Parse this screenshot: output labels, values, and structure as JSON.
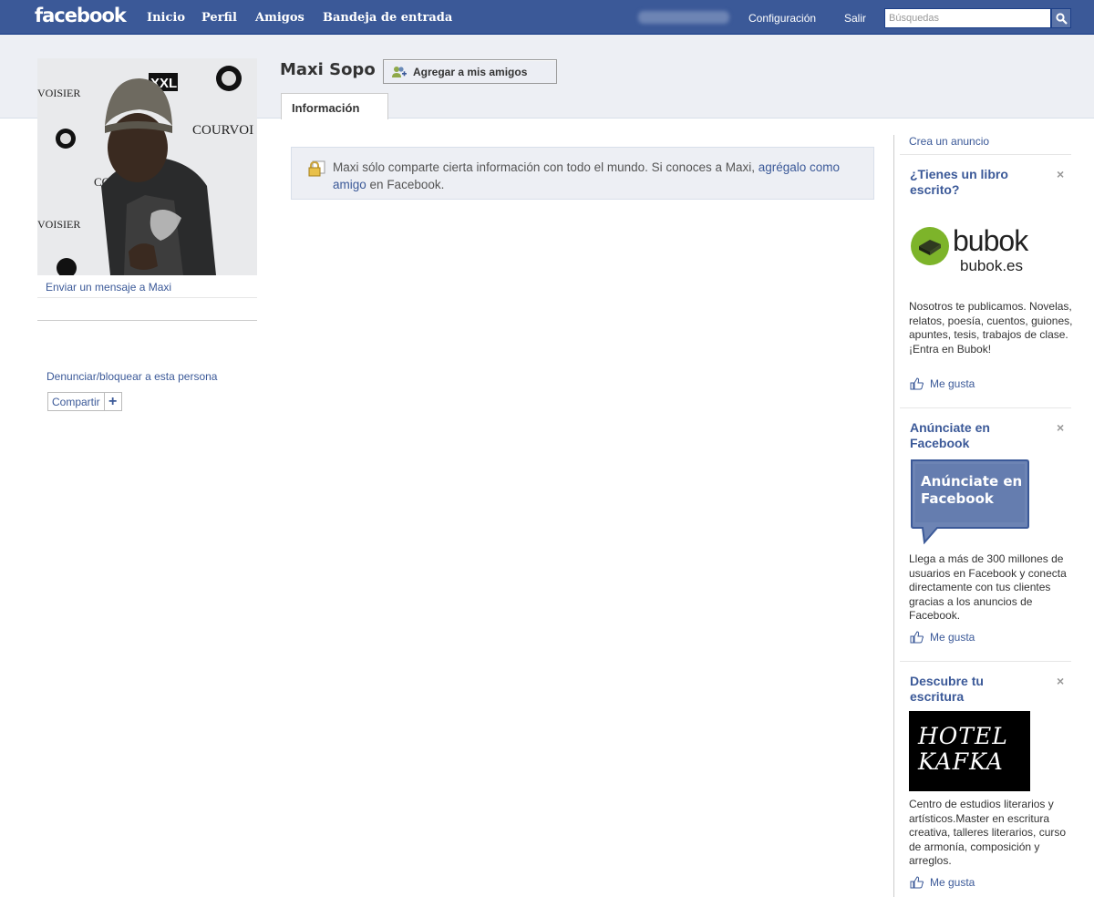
{
  "topbar": {
    "logo": "facebook",
    "nav": [
      "Inicio",
      "Perfil",
      "Amigos",
      "Bandeja de entrada"
    ],
    "settings": "Configuración",
    "logout": "Salir",
    "search_placeholder": "Búsquedas"
  },
  "profile": {
    "name": "Maxi Sopo",
    "add_friend": "Agregar a mis amigos",
    "tab": "Información",
    "send_message": "Enviar un mensaje a Maxi",
    "report": "Denunciar/bloquear a esta persona",
    "share": "Compartir",
    "photo_logos": [
      "VOISIER",
      "XXL",
      "COURVOI",
      "CO",
      "VOISIER"
    ]
  },
  "notice": {
    "text_before": "Maxi sólo comparte cierta información con todo el mundo. Si conoces a Maxi,",
    "link": "agrégalo como amigo",
    "text_after": "en Facebook."
  },
  "sidebar": {
    "create_ad": "Crea un anuncio",
    "like_label": "Me gusta",
    "ads": [
      {
        "title": "¿Tienes un libro escrito?",
        "brand": "bubok",
        "domain": "bubok.es",
        "body": "Nosotros te publicamos. Novelas, relatos, poesía, cuentos, guiones, apuntes, tesis, trabajos de clase. ¡Entra en Bubok!"
      },
      {
        "title": "Anúnciate en Facebook",
        "image_text": "Anúnciate en Facebook",
        "body": "Llega a más de 300 millones de usuarios en Facebook y conecta directamente con tus clientes gracias a los anuncios de Facebook."
      },
      {
        "title": "Descubre tu escritura",
        "image_text": "HOTEL KAFKA",
        "body": "Centro de estudios literarios y artísticos.Master en escritura creativa, talleres literarios, curso de armonía, composición y arreglos."
      }
    ]
  },
  "colors": {
    "brand": "#3b5998",
    "header_band": "#edeff4",
    "link": "#3b5998"
  }
}
